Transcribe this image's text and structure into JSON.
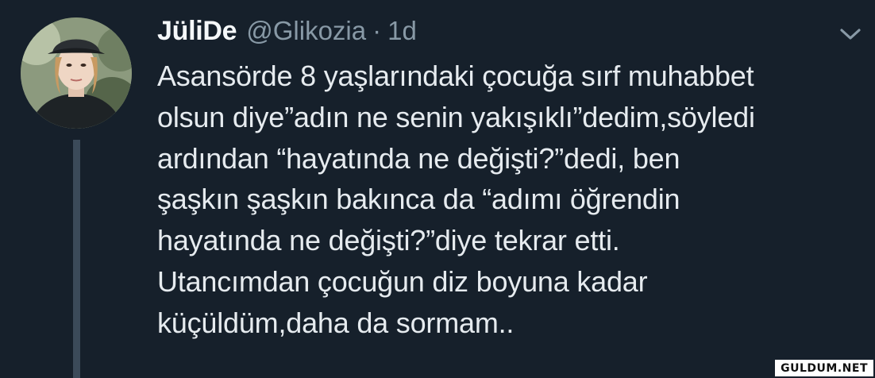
{
  "user": {
    "display_name": "JüliDe",
    "handle": "@Glikozia",
    "separator": "·",
    "time": "1d"
  },
  "icons": {
    "avatar": "profile-photo",
    "menu": "chevron-down-icon"
  },
  "tweet": {
    "lines": [
      "Asansörde 8 yaşlarındaki çocuğa sırf muhabbet",
      "olsun diye”adın ne senin yakışıklı”dedim,söyledi",
      "ardından “hayatında ne değişti?”dedi, ben",
      "şaşkın şaşkın bakınca da “adımı öğrendin",
      "hayatında ne değişti?”diye tekrar etti.",
      "Utancımdan çocuğun diz boyuna kadar",
      "küçüldüm,daha da sormam.."
    ]
  },
  "watermark": "GULDUM.NET",
  "colors": {
    "background": "#16202b",
    "text": "#e6ebef",
    "secondary_text": "#8899a6",
    "thread_line": "#3b4a59"
  }
}
